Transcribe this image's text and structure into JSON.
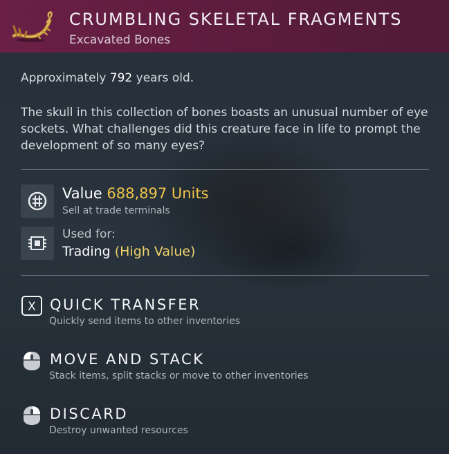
{
  "item": {
    "title": "CRUMBLING SKELETAL FRAGMENTS",
    "subtitle": "Excavated Bones",
    "icon": "bone-fragments-icon",
    "header_color": "#6b1f46"
  },
  "age": {
    "prefix": "Approximately",
    "years": "792",
    "suffix": "years old."
  },
  "description": "The skull in this collection of bones boasts an unusual number of eye sockets. What challenges did this creature face in life to prompt the development of so many eyes?",
  "value": {
    "label": "Value",
    "amount": "688,897 Units",
    "sub": "Sell at trade terminals",
    "icon": "units-currency-icon",
    "amount_color": "#f0c44a"
  },
  "used_for": {
    "label": "Used for:",
    "category": "Trading",
    "qualifier": "(High Value)",
    "icon": "trade-chip-icon"
  },
  "actions": [
    {
      "title": "QUICK TRANSFER",
      "sub": "Quickly send items to other inventories",
      "icon": "x-key-icon"
    },
    {
      "title": "MOVE AND STACK",
      "sub": "Stack items, split stacks or move to other inventories",
      "icon": "mouse-left-click-icon"
    },
    {
      "title": "DISCARD",
      "sub": "Destroy unwanted resources",
      "icon": "mouse-right-click-icon"
    }
  ]
}
